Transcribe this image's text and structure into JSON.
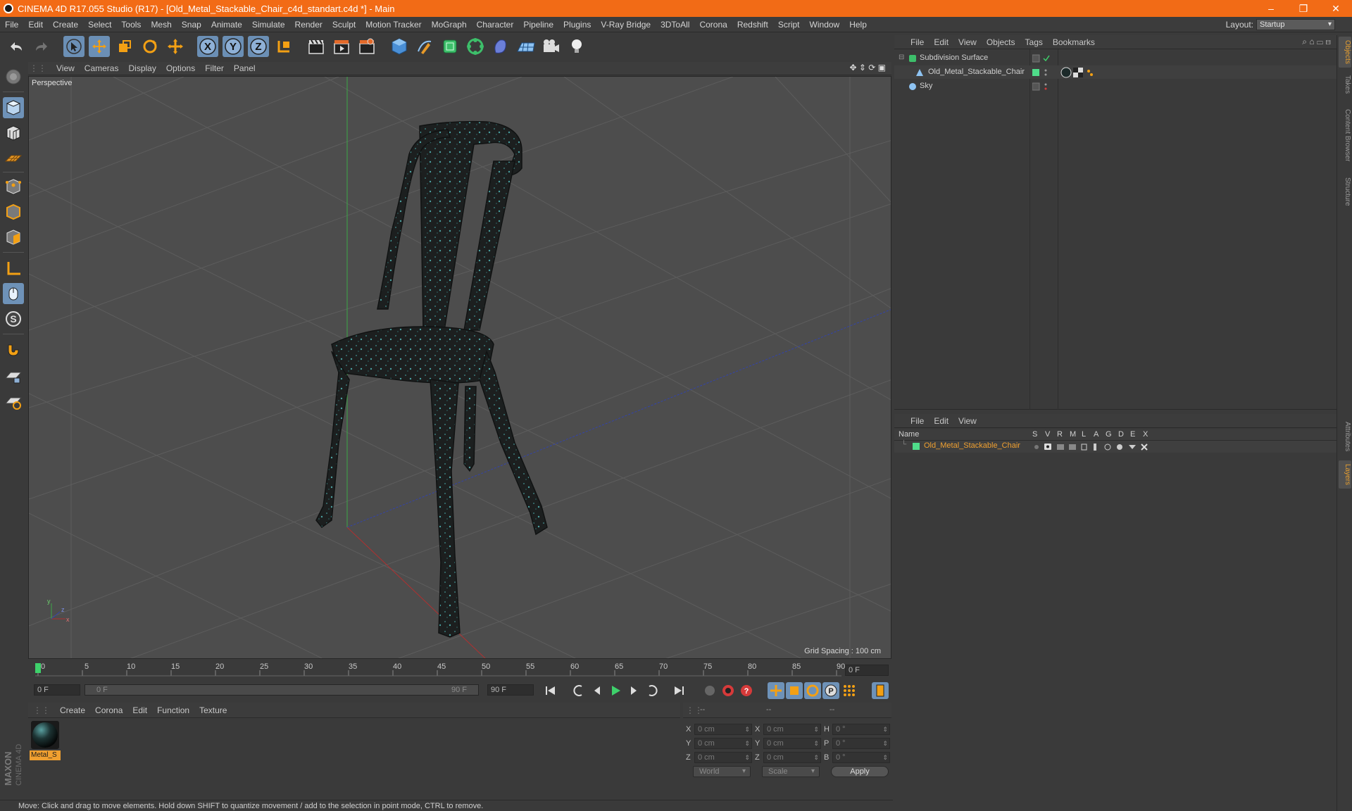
{
  "window": {
    "title": "CINEMA 4D R17.055 Studio (R17) - [Old_Metal_Stackable_Chair_c4d_standart.c4d *] - Main",
    "controls": [
      "–",
      "❐",
      "✕"
    ]
  },
  "menubar": {
    "items": [
      "File",
      "Edit",
      "Create",
      "Select",
      "Tools",
      "Mesh",
      "Snap",
      "Animate",
      "Simulate",
      "Render",
      "Sculpt",
      "Motion Tracker",
      "MoGraph",
      "Character",
      "Pipeline",
      "Plugins",
      "V-Ray Bridge",
      "3DToAll",
      "Corona",
      "Redshift",
      "Script",
      "Window",
      "Help"
    ],
    "layout_label": "Layout:",
    "layout_value": "Startup"
  },
  "viewport": {
    "menu": [
      "View",
      "Cameras",
      "Display",
      "Options",
      "Filter",
      "Panel"
    ],
    "label": "Perspective",
    "grid_spacing": "Grid Spacing : 100 cm",
    "axis_labels": {
      "y": "y",
      "z": "z",
      "x": "x"
    }
  },
  "timeline": {
    "ticks": [
      "0",
      "5",
      "10",
      "15",
      "20",
      "25",
      "30",
      "35",
      "40",
      "45",
      "50",
      "55",
      "60",
      "65",
      "70",
      "75",
      "80",
      "85",
      "90"
    ],
    "current_frame_field": "0 F",
    "start_field": "0 F",
    "range_start": "0 F",
    "range_end": "90 F",
    "end_field": "90 F"
  },
  "material_manager": {
    "menu": [
      "Create",
      "Corona",
      "Edit",
      "Function",
      "Texture"
    ],
    "materials": [
      {
        "name": "Metal_S"
      }
    ]
  },
  "coordinates": {
    "headers": [
      "--",
      "--",
      "--"
    ],
    "rows": [
      {
        "axis": "X",
        "pos": "0 cm",
        "axis2": "X",
        "size": "0 cm",
        "rot_axis": "H",
        "rot": "0 °"
      },
      {
        "axis": "Y",
        "pos": "0 cm",
        "axis2": "Y",
        "size": "0 cm",
        "rot_axis": "P",
        "rot": "0 °"
      },
      {
        "axis": "Z",
        "pos": "0 cm",
        "axis2": "Z",
        "size": "0 cm",
        "rot_axis": "B",
        "rot": "0 °"
      }
    ],
    "mode_world": "World",
    "mode_scale": "Scale",
    "apply": "Apply"
  },
  "status": "Move: Click and drag to move elements. Hold down SHIFT to quantize movement / add to the selection in point mode, CTRL to remove.",
  "object_manager": {
    "menu": [
      "File",
      "Edit",
      "View",
      "Objects",
      "Tags",
      "Bookmarks"
    ],
    "objects": [
      {
        "name": "Subdivision Surface"
      },
      {
        "name": "Old_Metal_Stackable_Chair"
      },
      {
        "name": "Sky"
      }
    ]
  },
  "layer_manager": {
    "menu": [
      "File",
      "Edit",
      "View"
    ],
    "columns": [
      "Name",
      "S",
      "V",
      "R",
      "M",
      "L",
      "A",
      "G",
      "D",
      "E",
      "X"
    ],
    "layers": [
      {
        "name": "Old_Metal_Stackable_Chair",
        "color": "#4fdc8a"
      }
    ]
  },
  "side_tabs": [
    "Objects",
    "Takes",
    "Content Browser",
    "Structure",
    "Attributes",
    "Layers"
  ],
  "brand": {
    "maxon": "MAXON",
    "product": "CINEMA 4D"
  },
  "colors": {
    "accent": "#f26b16",
    "selection": "#6e92b8",
    "layer_name": "#f0a030"
  }
}
